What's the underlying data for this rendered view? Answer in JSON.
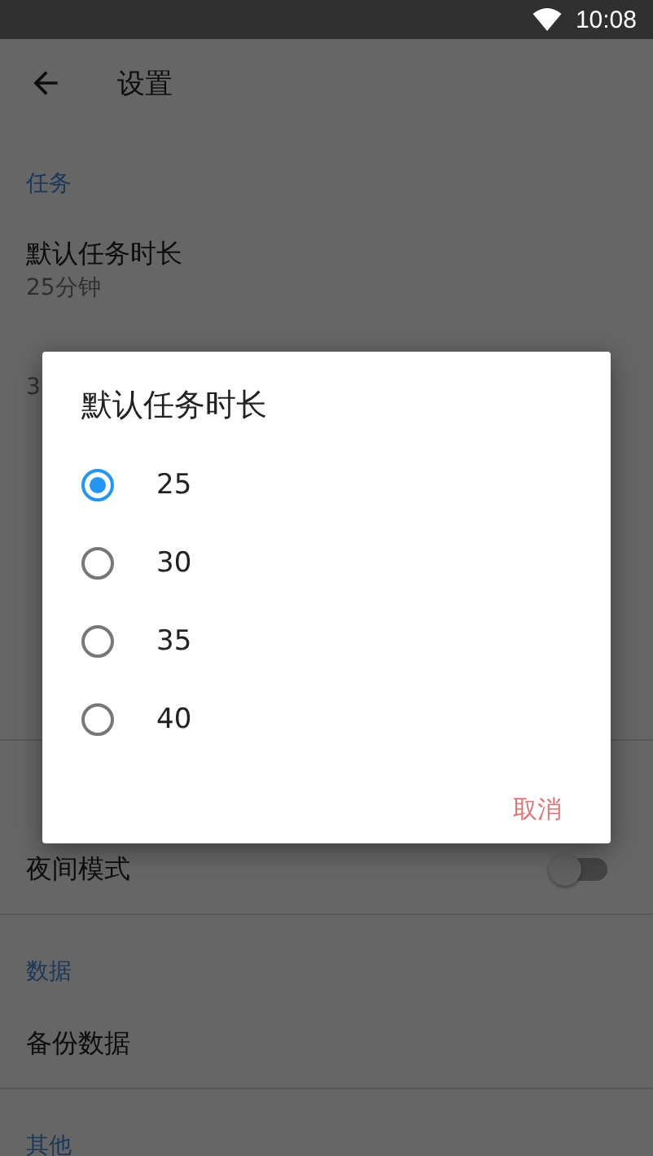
{
  "status_bar": {
    "time": "10:08"
  },
  "app_bar": {
    "title": "设置"
  },
  "sections": [
    {
      "header": "任务",
      "items": [
        {
          "kind": "two_line",
          "title": "默认任务时长",
          "subtitle": "25分钟"
        },
        {
          "kind": "two_line",
          "subtitle": "3"
        },
        {
          "kind": "two_line"
        },
        {
          "kind": "one_line"
        },
        {
          "kind": "one_line"
        }
      ]
    },
    {
      "items": [
        {
          "kind": "switch",
          "title": "夜间模式",
          "on": false
        }
      ]
    },
    {
      "header": "数据",
      "items": [
        {
          "kind": "one_line",
          "title": "备份数据"
        }
      ]
    },
    {
      "header": "其他"
    }
  ],
  "dialog": {
    "title": "默认任务时长",
    "options": [
      {
        "label": "25",
        "selected": true
      },
      {
        "label": "30",
        "selected": false
      },
      {
        "label": "35",
        "selected": false
      },
      {
        "label": "40",
        "selected": false
      }
    ],
    "cancel": "取消"
  }
}
